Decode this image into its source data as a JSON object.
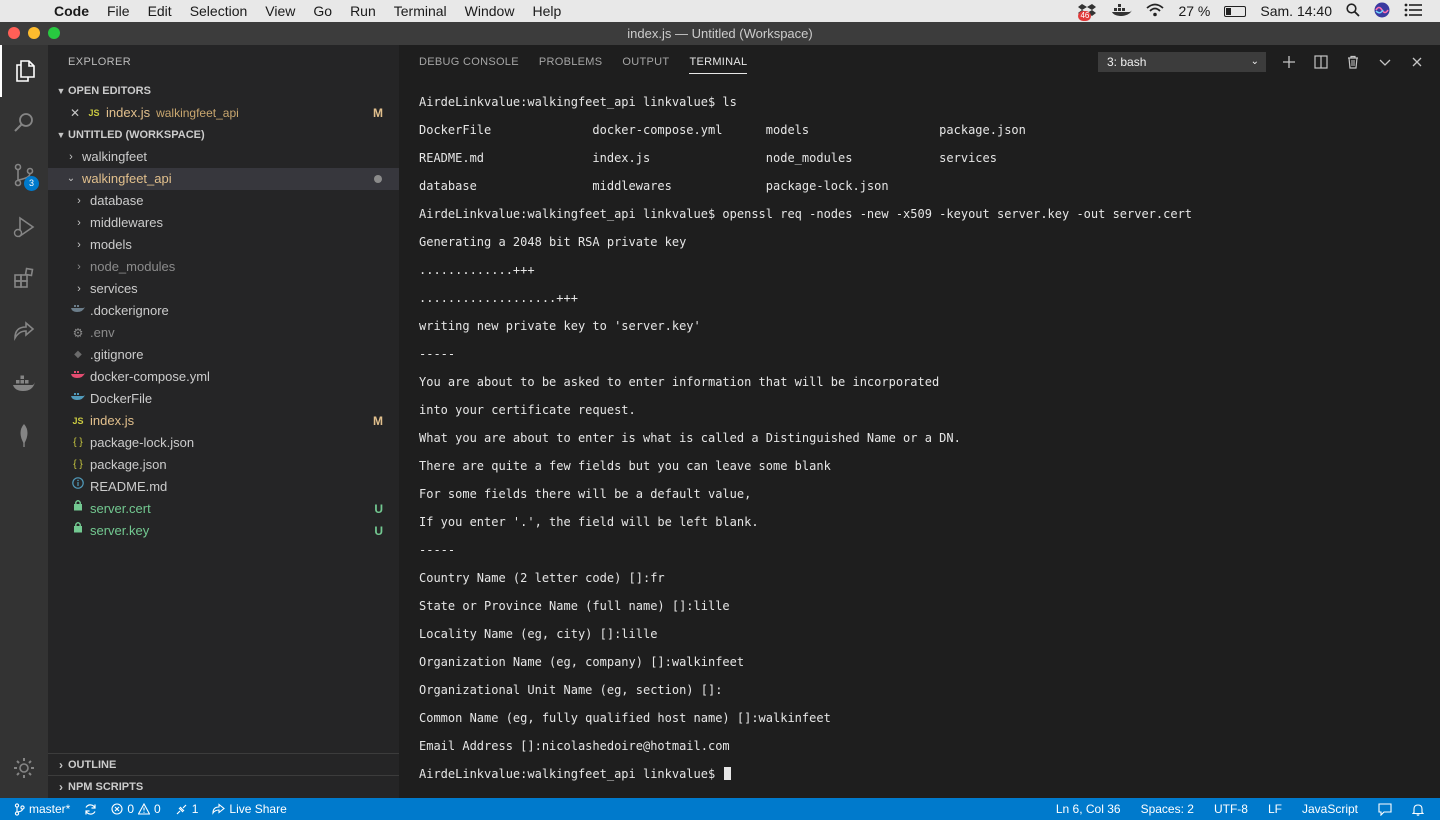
{
  "menubar": {
    "app": "Code",
    "items": [
      "File",
      "Edit",
      "Selection",
      "View",
      "Go",
      "Run",
      "Terminal",
      "Window",
      "Help"
    ],
    "notification_count": "46",
    "battery_percent": "27 %",
    "battery_level": 0.27,
    "clock": "Sam. 14:40"
  },
  "window": {
    "title": "index.js — Untitled (Workspace)"
  },
  "activity": {
    "scm_count": "3"
  },
  "sidebar": {
    "title": "EXPLORER",
    "open_editors": {
      "header": "OPEN EDITORS",
      "item": {
        "name": "index.js",
        "icon": "JS",
        "desc": "walkingfeet_api",
        "status": "M"
      }
    },
    "workspace": {
      "header": "UNTITLED (WORKSPACE)",
      "folder1": "walkingfeet",
      "folder2": "walkingfeet_api",
      "children": [
        {
          "name": "database",
          "type": "folder"
        },
        {
          "name": "middlewares",
          "type": "folder"
        },
        {
          "name": "models",
          "type": "folder"
        },
        {
          "name": "node_modules",
          "type": "folder"
        },
        {
          "name": "services",
          "type": "folder"
        },
        {
          "name": ".dockerignore",
          "icon": "docker"
        },
        {
          "name": ".env",
          "icon": "gear"
        },
        {
          "name": ".gitignore",
          "icon": "diamond"
        },
        {
          "name": "docker-compose.yml",
          "icon": "docker"
        },
        {
          "name": "DockerFile",
          "icon": "docker"
        },
        {
          "name": "index.js",
          "icon": "JS",
          "status": "M"
        },
        {
          "name": "package-lock.json",
          "icon": "{ }"
        },
        {
          "name": "package.json",
          "icon": "{ }"
        },
        {
          "name": "README.md",
          "icon": "info"
        },
        {
          "name": "server.cert",
          "icon": "lock",
          "status": "U"
        },
        {
          "name": "server.key",
          "icon": "lock",
          "status": "U"
        }
      ]
    },
    "outline": "OUTLINE",
    "npm_scripts": "NPM SCRIPTS"
  },
  "panel": {
    "tabs": [
      "DEBUG CONSOLE",
      "PROBLEMS",
      "OUTPUT",
      "TERMINAL"
    ],
    "active_tab": "TERMINAL",
    "terminal_select": "3: bash",
    "lines": [
      "AirdeLinkvalue:walkingfeet_api linkvalue$ ls",
      "DockerFile              docker-compose.yml      models                  package.json",
      "README.md               index.js                node_modules            services",
      "database                middlewares             package-lock.json",
      "AirdeLinkvalue:walkingfeet_api linkvalue$ openssl req -nodes -new -x509 -keyout server.key -out server.cert",
      "Generating a 2048 bit RSA private key",
      ".............+++",
      "...................+++",
      "writing new private key to 'server.key'",
      "-----",
      "You are about to be asked to enter information that will be incorporated",
      "into your certificate request.",
      "What you are about to enter is what is called a Distinguished Name or a DN.",
      "There are quite a few fields but you can leave some blank",
      "For some fields there will be a default value,",
      "If you enter '.', the field will be left blank.",
      "-----",
      "Country Name (2 letter code) []:fr",
      "State or Province Name (full name) []:lille",
      "Locality Name (eg, city) []:lille",
      "Organization Name (eg, company) []:walkinfeet",
      "Organizational Unit Name (eg, section) []:",
      "Common Name (eg, fully qualified host name) []:walkinfeet",
      "Email Address []:nicolashedoire@hotmail.com"
    ],
    "prompt": "AirdeLinkvalue:walkingfeet_api linkvalue$ "
  },
  "statusbar": {
    "branch": "master*",
    "errors": "0",
    "warnings": "0",
    "ports": "1",
    "live_share": "Live Share",
    "position": "Ln 6, Col 36",
    "spaces": "Spaces: 2",
    "encoding": "UTF-8",
    "eol": "LF",
    "language": "JavaScript"
  },
  "colors": {
    "accent": "#007acc",
    "modified": "#e2c08d",
    "untracked": "#73c991",
    "js_icon": "#cbcb41",
    "docker_icon": "#519aba",
    "compose_icon": "#e34c70"
  }
}
